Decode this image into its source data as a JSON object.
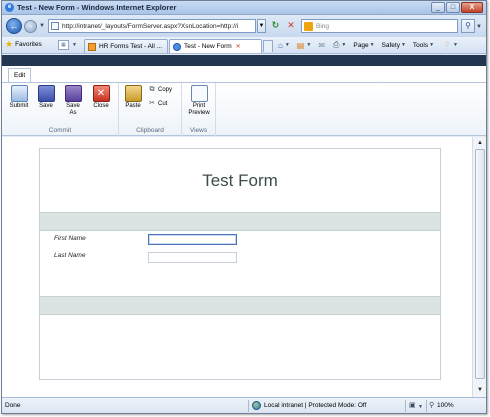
{
  "window": {
    "title": "Test - New Form - Windows Internet Explorer",
    "minimize": "_",
    "maximize": "□",
    "close": "X"
  },
  "address_bar": {
    "url": "http://intranet/_layouts/FormServer.aspx?XsnLocation=http://i",
    "search_placeholder": "Bing"
  },
  "command_bar": {
    "favorites_label": "Favorites",
    "tabs": [
      {
        "label": "HR Forms Test - All ..."
      },
      {
        "label": "Test - New Form"
      }
    ],
    "tools": [
      {
        "label": "Page"
      },
      {
        "label": "Safety"
      },
      {
        "label": "Tools"
      }
    ]
  },
  "ribbon": {
    "tab_label": "Edit",
    "groups": [
      {
        "label": "Commit",
        "buttons": [
          {
            "label": "Submit"
          },
          {
            "label": "Save"
          },
          {
            "label": "Save\nAs"
          },
          {
            "label": "Close"
          }
        ]
      },
      {
        "label": "Clipboard",
        "buttons": [
          {
            "label": "Paste"
          },
          {
            "label": "Copy"
          },
          {
            "label": "Cut"
          }
        ]
      },
      {
        "label": "Views",
        "buttons": [
          {
            "label": "Print\nPreview"
          }
        ]
      }
    ]
  },
  "form": {
    "title": "Test Form",
    "fields": [
      {
        "label": "First Name",
        "value": ""
      },
      {
        "label": "Last Name",
        "value": ""
      }
    ]
  },
  "status_bar": {
    "status": "Done",
    "zone": "Local intranet | Protected Mode: Off",
    "zoom": "100%"
  },
  "colors": {
    "band": "#23364f",
    "form_section": "#dbe4e2",
    "form_title": "#3b4c4a"
  }
}
